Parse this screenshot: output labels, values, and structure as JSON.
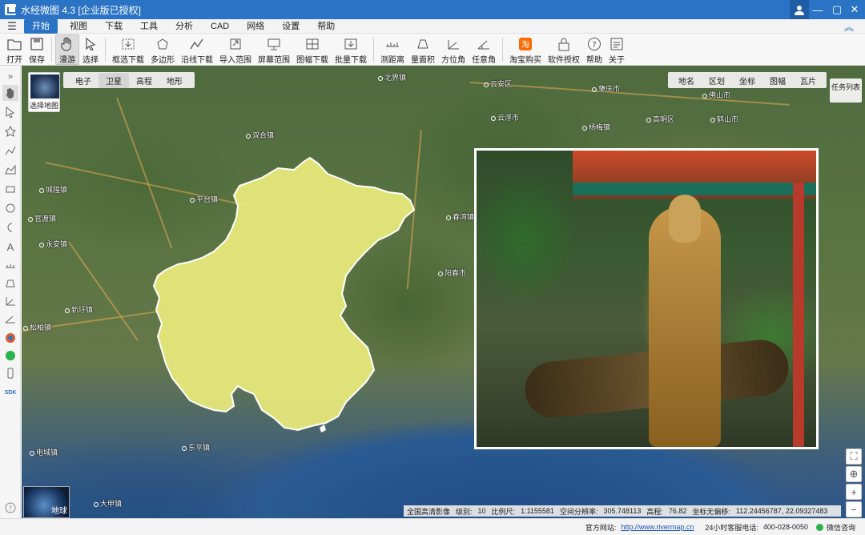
{
  "window": {
    "title": "水经微图 4.3 [企业版已授权]",
    "controls": {
      "minimize": "—",
      "maximize": "▢",
      "close": "✕"
    }
  },
  "menu": {
    "items": [
      "开始",
      "视图",
      "下载",
      "工具",
      "分析",
      "CAD",
      "网络",
      "设置",
      "帮助"
    ],
    "active": "开始"
  },
  "toolbar": {
    "items": [
      {
        "label": "打开",
        "icon": "folder-icon"
      },
      {
        "label": "保存",
        "icon": "save-icon"
      },
      {
        "label": "漫游",
        "icon": "hand-icon",
        "active": true
      },
      {
        "label": "选择",
        "icon": "pointer-icon"
      },
      {
        "label": "框选下载",
        "icon": "box-download-icon"
      },
      {
        "label": "多边形",
        "icon": "polygon-icon"
      },
      {
        "label": "沿线下载",
        "icon": "line-download-icon"
      },
      {
        "label": "导入范围",
        "icon": "import-icon"
      },
      {
        "label": "屏幕范围",
        "icon": "screen-icon"
      },
      {
        "label": "图幅下载",
        "icon": "grid-icon"
      },
      {
        "label": "批量下载",
        "icon": "batch-download-icon"
      },
      {
        "label": "测距离",
        "icon": "ruler-icon"
      },
      {
        "label": "量面积",
        "icon": "area-icon"
      },
      {
        "label": "方位角",
        "icon": "bearing-icon"
      },
      {
        "label": "任意角",
        "icon": "angle-icon"
      },
      {
        "label": "淘宝购买",
        "icon": "taobao-icon"
      },
      {
        "label": "软件授权",
        "icon": "lock-icon"
      },
      {
        "label": "帮助",
        "icon": "help-icon"
      },
      {
        "label": "关于",
        "icon": "about-icon"
      }
    ]
  },
  "map": {
    "maptype_label": "选择地图",
    "layer_tabs": [
      "电子",
      "卫星",
      "高程",
      "地形"
    ],
    "active_layer": "卫星",
    "overlay_tabs": [
      "地名",
      "区划",
      "坐标",
      "图幅",
      "瓦片"
    ],
    "task_list": "任务列表",
    "globe_label": "地球",
    "places": [
      {
        "name": "云安区"
      },
      {
        "name": "肇庆市"
      },
      {
        "name": "云浮市"
      },
      {
        "name": "佛山市"
      },
      {
        "name": "城隍镇"
      },
      {
        "name": "官渡镇"
      },
      {
        "name": "永安镇"
      },
      {
        "name": "新圩镇"
      },
      {
        "name": "松柏镇"
      },
      {
        "name": "阳春市"
      },
      {
        "name": "东平镇"
      },
      {
        "name": "平台镇"
      },
      {
        "name": "北界镇"
      },
      {
        "name": "电城镇"
      },
      {
        "name": "大甲镇"
      },
      {
        "name": "春湾镇"
      },
      {
        "name": "高明区"
      },
      {
        "name": "杨梅镇"
      },
      {
        "name": "鹤山市"
      },
      {
        "name": "双合镇"
      }
    ],
    "status": {
      "source": "全国高清影像",
      "level_label": "级别:",
      "level": "10",
      "scale_label": "比例尺:",
      "scale": "1:1155581",
      "resolution_label": "空间分辨率:",
      "resolution": "305.748113",
      "elevation_label": "高程:",
      "elevation": "76.82",
      "offset_label": "坐标无偏移:",
      "coords": "112.24456787, 22.09327483"
    }
  },
  "footer": {
    "site_label": "官方网站:",
    "site_url": "http://www.rivermap.cn",
    "hotline_label": "24小时客服电话:",
    "hotline": "400-028-0050",
    "wechat": "微信咨询"
  },
  "colors": {
    "titlebar": "#2b73c4",
    "region_fill": "#e6e87a",
    "accent": "#2b73c4"
  }
}
